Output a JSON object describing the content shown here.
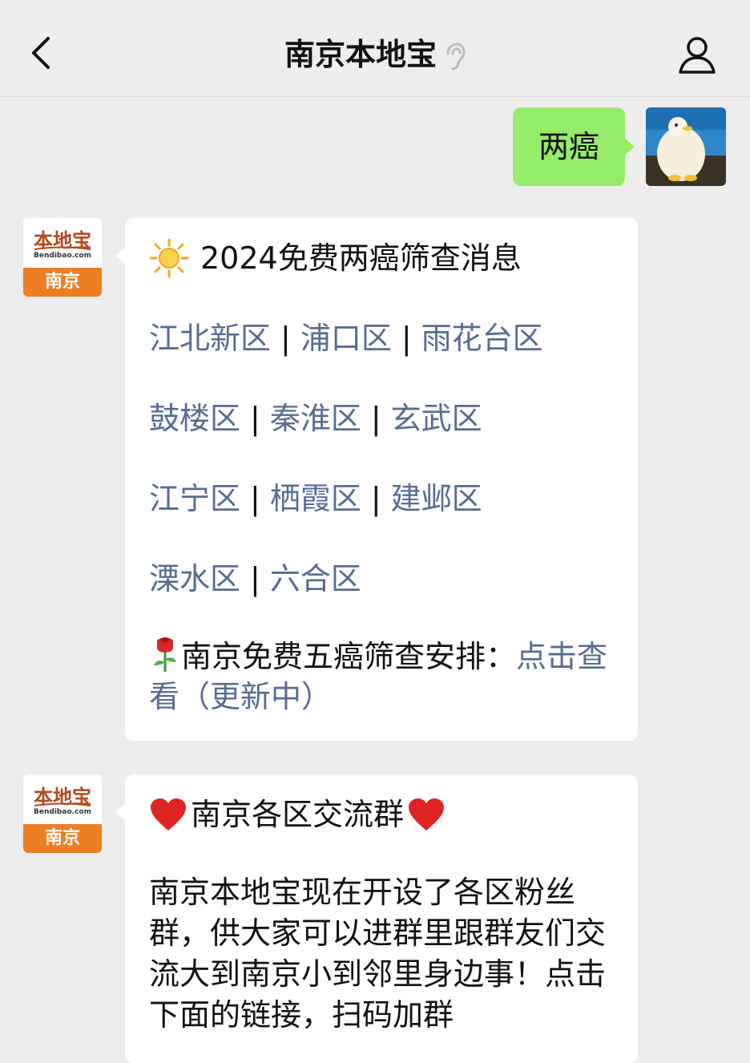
{
  "header": {
    "title": "南京本地宝"
  },
  "outgoing": {
    "text": "两癌"
  },
  "bot_avatar": {
    "brand": "本地宝",
    "url": "Bendibao.com",
    "city": "南京"
  },
  "message1": {
    "title": "2024免费两癌筛查消息",
    "rows": [
      [
        "江北新区",
        "浦口区",
        "雨花台区"
      ],
      [
        "鼓楼区",
        "秦淮区",
        "玄武区"
      ],
      [
        "江宁区",
        "栖霞区",
        "建邺区"
      ],
      [
        "溧水区",
        "六合区"
      ]
    ],
    "separator": "|",
    "notice_text": "南京免费五癌筛查安排：",
    "notice_link": "点击查看（更新中）"
  },
  "message2": {
    "title": "南京各区交流群",
    "body": "南京本地宝现在开设了各区粉丝群，供大家可以进群里跟群友们交流大到南京小到邻里身边事！点击下面的链接，扫码加群"
  },
  "colors": {
    "bubble_out": "#95ec69",
    "link": "#576b95",
    "background": "#ededed"
  }
}
